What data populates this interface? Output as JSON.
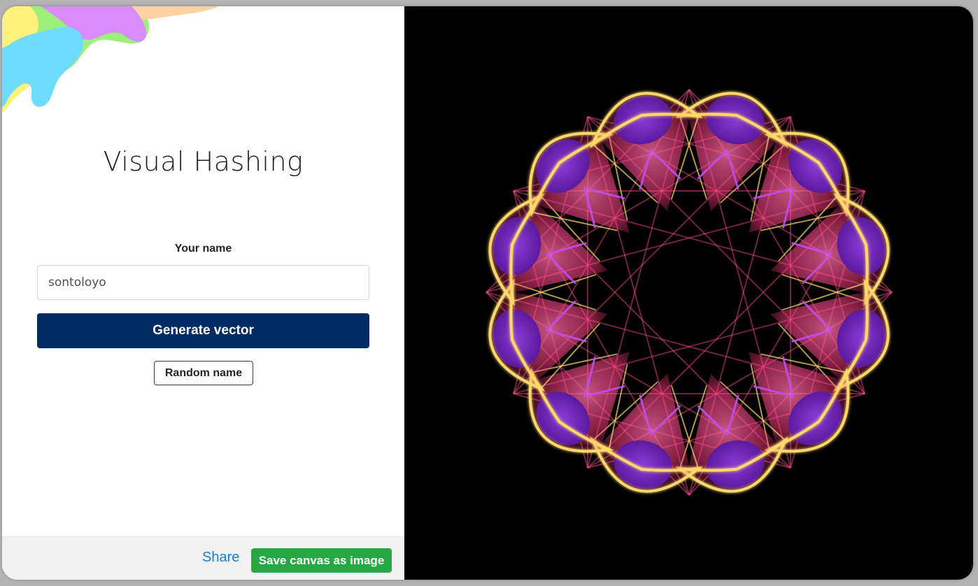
{
  "app": {
    "title": "Visual Hashing"
  },
  "form": {
    "name_label": "Your name",
    "name_value": "sontoloyo",
    "generate_label": "Generate vector",
    "random_label": "Random name"
  },
  "footer": {
    "share_label": "Share",
    "save_label": "Save canvas as image"
  },
  "colors": {
    "primary_button": "#012b63",
    "save_button": "#28a745",
    "share_link": "#1a7fd4",
    "canvas_background": "#000000",
    "pattern_gold": "#ffd76a",
    "pattern_pink": "#ff4d8d",
    "pattern_purple": "#7a2bc2"
  },
  "canvas": {
    "petal_count": 12
  }
}
